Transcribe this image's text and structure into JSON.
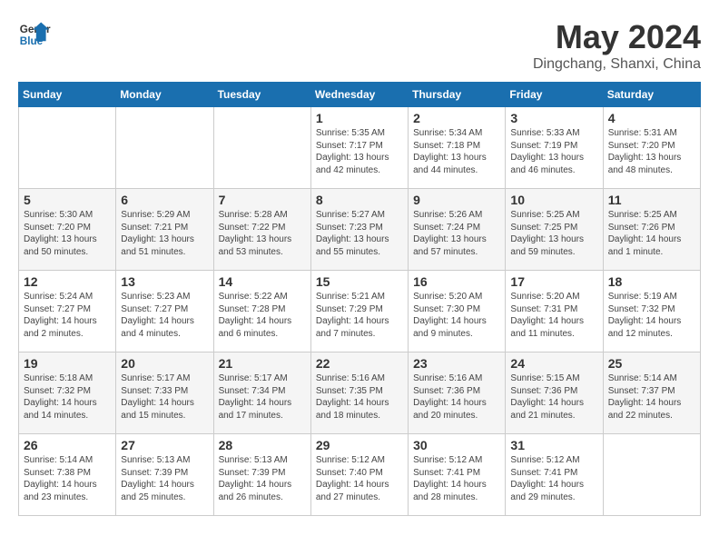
{
  "header": {
    "logo_line1": "General",
    "logo_line2": "Blue",
    "month": "May 2024",
    "location": "Dingchang, Shanxi, China"
  },
  "weekdays": [
    "Sunday",
    "Monday",
    "Tuesday",
    "Wednesday",
    "Thursday",
    "Friday",
    "Saturday"
  ],
  "weeks": [
    [
      {
        "day": "",
        "info": ""
      },
      {
        "day": "",
        "info": ""
      },
      {
        "day": "",
        "info": ""
      },
      {
        "day": "1",
        "info": "Sunrise: 5:35 AM\nSunset: 7:17 PM\nDaylight: 13 hours\nand 42 minutes."
      },
      {
        "day": "2",
        "info": "Sunrise: 5:34 AM\nSunset: 7:18 PM\nDaylight: 13 hours\nand 44 minutes."
      },
      {
        "day": "3",
        "info": "Sunrise: 5:33 AM\nSunset: 7:19 PM\nDaylight: 13 hours\nand 46 minutes."
      },
      {
        "day": "4",
        "info": "Sunrise: 5:31 AM\nSunset: 7:20 PM\nDaylight: 13 hours\nand 48 minutes."
      }
    ],
    [
      {
        "day": "5",
        "info": "Sunrise: 5:30 AM\nSunset: 7:20 PM\nDaylight: 13 hours\nand 50 minutes."
      },
      {
        "day": "6",
        "info": "Sunrise: 5:29 AM\nSunset: 7:21 PM\nDaylight: 13 hours\nand 51 minutes."
      },
      {
        "day": "7",
        "info": "Sunrise: 5:28 AM\nSunset: 7:22 PM\nDaylight: 13 hours\nand 53 minutes."
      },
      {
        "day": "8",
        "info": "Sunrise: 5:27 AM\nSunset: 7:23 PM\nDaylight: 13 hours\nand 55 minutes."
      },
      {
        "day": "9",
        "info": "Sunrise: 5:26 AM\nSunset: 7:24 PM\nDaylight: 13 hours\nand 57 minutes."
      },
      {
        "day": "10",
        "info": "Sunrise: 5:25 AM\nSunset: 7:25 PM\nDaylight: 13 hours\nand 59 minutes."
      },
      {
        "day": "11",
        "info": "Sunrise: 5:25 AM\nSunset: 7:26 PM\nDaylight: 14 hours\nand 1 minute."
      }
    ],
    [
      {
        "day": "12",
        "info": "Sunrise: 5:24 AM\nSunset: 7:27 PM\nDaylight: 14 hours\nand 2 minutes."
      },
      {
        "day": "13",
        "info": "Sunrise: 5:23 AM\nSunset: 7:27 PM\nDaylight: 14 hours\nand 4 minutes."
      },
      {
        "day": "14",
        "info": "Sunrise: 5:22 AM\nSunset: 7:28 PM\nDaylight: 14 hours\nand 6 minutes."
      },
      {
        "day": "15",
        "info": "Sunrise: 5:21 AM\nSunset: 7:29 PM\nDaylight: 14 hours\nand 7 minutes."
      },
      {
        "day": "16",
        "info": "Sunrise: 5:20 AM\nSunset: 7:30 PM\nDaylight: 14 hours\nand 9 minutes."
      },
      {
        "day": "17",
        "info": "Sunrise: 5:20 AM\nSunset: 7:31 PM\nDaylight: 14 hours\nand 11 minutes."
      },
      {
        "day": "18",
        "info": "Sunrise: 5:19 AM\nSunset: 7:32 PM\nDaylight: 14 hours\nand 12 minutes."
      }
    ],
    [
      {
        "day": "19",
        "info": "Sunrise: 5:18 AM\nSunset: 7:32 PM\nDaylight: 14 hours\nand 14 minutes."
      },
      {
        "day": "20",
        "info": "Sunrise: 5:17 AM\nSunset: 7:33 PM\nDaylight: 14 hours\nand 15 minutes."
      },
      {
        "day": "21",
        "info": "Sunrise: 5:17 AM\nSunset: 7:34 PM\nDaylight: 14 hours\nand 17 minutes."
      },
      {
        "day": "22",
        "info": "Sunrise: 5:16 AM\nSunset: 7:35 PM\nDaylight: 14 hours\nand 18 minutes."
      },
      {
        "day": "23",
        "info": "Sunrise: 5:16 AM\nSunset: 7:36 PM\nDaylight: 14 hours\nand 20 minutes."
      },
      {
        "day": "24",
        "info": "Sunrise: 5:15 AM\nSunset: 7:36 PM\nDaylight: 14 hours\nand 21 minutes."
      },
      {
        "day": "25",
        "info": "Sunrise: 5:14 AM\nSunset: 7:37 PM\nDaylight: 14 hours\nand 22 minutes."
      }
    ],
    [
      {
        "day": "26",
        "info": "Sunrise: 5:14 AM\nSunset: 7:38 PM\nDaylight: 14 hours\nand 23 minutes."
      },
      {
        "day": "27",
        "info": "Sunrise: 5:13 AM\nSunset: 7:39 PM\nDaylight: 14 hours\nand 25 minutes."
      },
      {
        "day": "28",
        "info": "Sunrise: 5:13 AM\nSunset: 7:39 PM\nDaylight: 14 hours\nand 26 minutes."
      },
      {
        "day": "29",
        "info": "Sunrise: 5:12 AM\nSunset: 7:40 PM\nDaylight: 14 hours\nand 27 minutes."
      },
      {
        "day": "30",
        "info": "Sunrise: 5:12 AM\nSunset: 7:41 PM\nDaylight: 14 hours\nand 28 minutes."
      },
      {
        "day": "31",
        "info": "Sunrise: 5:12 AM\nSunset: 7:41 PM\nDaylight: 14 hours\nand 29 minutes."
      },
      {
        "day": "",
        "info": ""
      }
    ]
  ]
}
